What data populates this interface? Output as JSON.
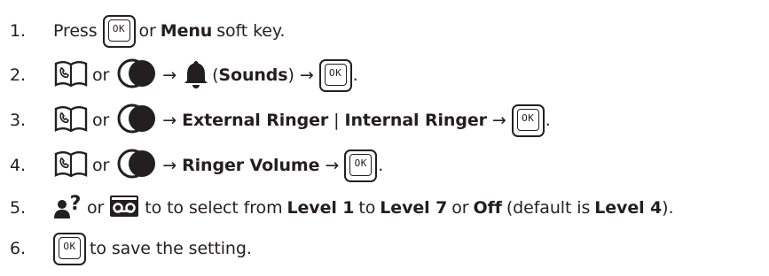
{
  "steps": [
    {
      "num": "1.",
      "t1": "Press",
      "key": "OK",
      "t2": "or",
      "b1": "Menu",
      "t3": "soft key."
    },
    {
      "num": "2.",
      "or": "or",
      "arrow1": "→",
      "paren_open": "(",
      "b1": "Sounds",
      "paren_close": ")",
      "arrow2": "→",
      "key": "OK",
      "end": "."
    },
    {
      "num": "3.",
      "or": "or",
      "arrow1": "→",
      "b1": "External Ringer",
      "sep": "|",
      "b2": "Internal Ringer",
      "arrow2": "→",
      "key": "OK",
      "end": "."
    },
    {
      "num": "4.",
      "or": "or",
      "arrow1": "→",
      "b1": "Ringer Volume",
      "arrow2": "→",
      "key": "OK",
      "end": "."
    },
    {
      "num": "5.",
      "or": "or",
      "t1": "to to select from",
      "b1": "Level 1",
      "t2": "to",
      "b2": "Level 7",
      "t3": "or",
      "b3": "Off",
      "t4": "(default is",
      "b4": "Level 4",
      "t5": ")."
    },
    {
      "num": "6.",
      "key": "OK",
      "t1": "to save the setting."
    }
  ],
  "icons": [
    "phonebook-icon",
    "volume-knob-icon",
    "bell-icon",
    "caller-id-icon",
    "answering-machine-icon"
  ]
}
